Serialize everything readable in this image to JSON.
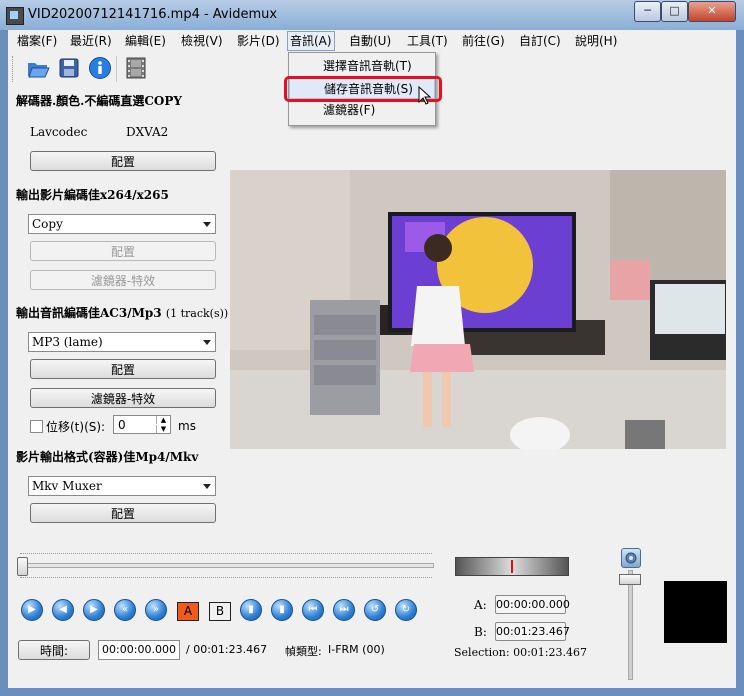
{
  "window": {
    "title": "VID20200712141716.mp4 - Avidemux",
    "minimize": "─",
    "maximize": "□",
    "close": "✕"
  },
  "menubar": {
    "items": [
      {
        "label": "檔案(F)"
      },
      {
        "label": "最近(R)"
      },
      {
        "label": "編輯(E)"
      },
      {
        "label": "檢視(V)"
      },
      {
        "label": "影片(D)"
      },
      {
        "label": "音訊(A)"
      },
      {
        "label": "自動(U)"
      },
      {
        "label": "工具(T)"
      },
      {
        "label": "前往(G)"
      },
      {
        "label": "自訂(C)"
      },
      {
        "label": "說明(H)"
      }
    ]
  },
  "audio_menu": {
    "items": [
      {
        "label": "選擇音訊音軌(T)"
      },
      {
        "label": "儲存音訊音軌(S)"
      },
      {
        "label": "濾鏡器(F)"
      }
    ]
  },
  "toolbar": {
    "icons": [
      "open-icon",
      "save-icon",
      "info-icon",
      "filmstrip-icon"
    ]
  },
  "decoder": {
    "heading": "解碼器.顏色.不編碼直選COPY",
    "codec": "Lavcodec",
    "hw": "DXVA2",
    "config_label": "配置"
  },
  "video_output": {
    "heading": "輸出影片編碼佳x264/x265",
    "selected": "Copy",
    "config_label": "配置",
    "filter_label": "濾鏡器-特效"
  },
  "audio_output": {
    "heading": "輸出音訊編碼佳AC3/Mp3",
    "tracks": "(1 track(s))",
    "selected": "MP3 (lame)",
    "config_label": "配置",
    "filter_label": "濾鏡器-特效",
    "shift_label": "位移(t)(S):",
    "shift_value": "0",
    "shift_unit": "ms"
  },
  "container": {
    "heading": "影片輸出格式(容器)佳Mp4/Mkv",
    "selected": "Mkv Muxer",
    "config_label": "配置"
  },
  "timeline": {
    "position": 0
  },
  "controls": {
    "marker_a": "A",
    "marker_b": "B",
    "a_label": "A:",
    "a_time": "00:00:00.000",
    "b_label": "B:",
    "b_time": "00:01:23.467",
    "selection": "Selection: 00:01:23.467"
  },
  "status": {
    "time_button": "時間:",
    "current_time": "00:00:00.000",
    "total_time": "/ 00:01:23.467",
    "frame_type_label": "幀類型:",
    "frame_type": "I-FRM (00)"
  },
  "colors": {
    "highlight_box": "#e4101d",
    "accent": "#2d7fd6"
  }
}
